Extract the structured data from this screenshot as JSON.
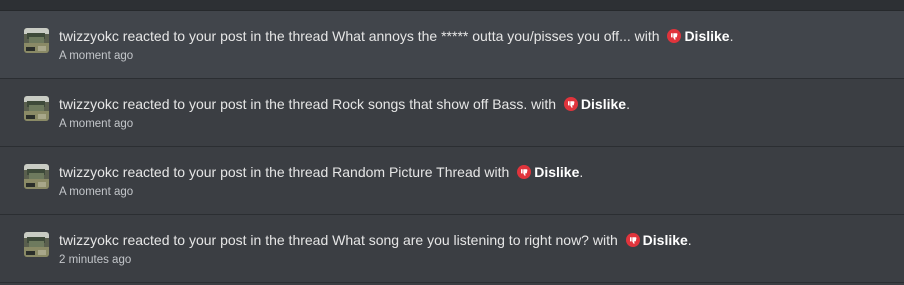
{
  "alerts": [
    {
      "username": "twizzyokc",
      "action": " reacted to your post in the thread ",
      "thread": "What annoys the ***** outta you/pisses you off...",
      "with_text": " with ",
      "reaction": "Dislike",
      "punct": ".",
      "time": "A moment ago",
      "unread": true
    },
    {
      "username": "twizzyokc",
      "action": " reacted to your post in the thread ",
      "thread": "Rock songs that show off Bass.",
      "with_text": " with ",
      "reaction": "Dislike",
      "punct": ".",
      "time": "A moment ago",
      "unread": false
    },
    {
      "username": "twizzyokc",
      "action": " reacted to your post in the thread ",
      "thread": "Random Picture Thread",
      "with_text": " with ",
      "reaction": "Dislike",
      "punct": ".",
      "time": "A moment ago",
      "unread": false
    },
    {
      "username": "twizzyokc",
      "action": " reacted to your post in the thread ",
      "thread": "What song are you listening to right now?",
      "with_text": " with ",
      "reaction": "Dislike",
      "punct": ".",
      "time": "2 minutes ago",
      "unread": false
    }
  ],
  "colors": {
    "reaction_red": "#e0343c",
    "text": "#e6e6e6",
    "time": "#c3c6ca"
  },
  "icons": {
    "avatar": "avatar-image",
    "reaction": "thumbs-down-icon"
  }
}
